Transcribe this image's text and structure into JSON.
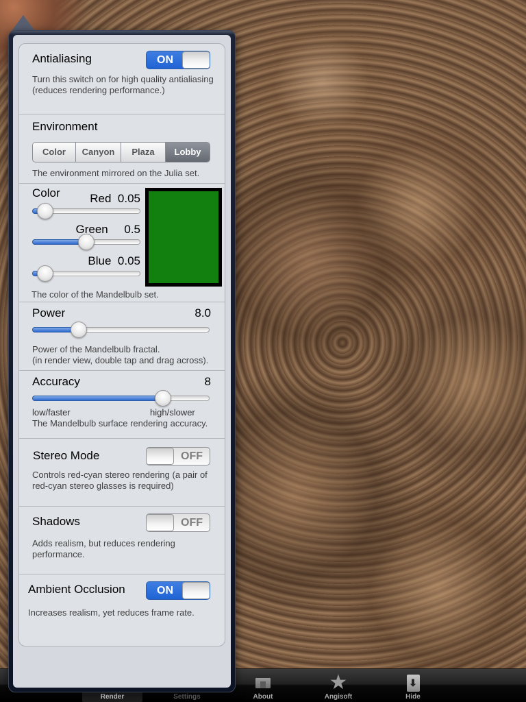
{
  "tabbar": {
    "tabs": [
      {
        "label": "Render",
        "icon": "render-icon",
        "selected": true
      },
      {
        "label": "Settings",
        "icon": "settings-icon",
        "selected": false
      },
      {
        "label": "About",
        "icon": "about-icon",
        "selected": false
      },
      {
        "label": "Angisoft",
        "icon": "star-icon",
        "selected": false
      },
      {
        "label": "Hide",
        "icon": "hide-arrow-icon",
        "selected": false
      }
    ]
  },
  "settings": {
    "antialiasing": {
      "title": "Antialiasing",
      "state": "ON",
      "description_line1": "Turn this switch on for high quality antialiasing",
      "description_line2": "(reduces rendering performance.)"
    },
    "environment": {
      "title": "Environment",
      "options": [
        "Color",
        "Canyon",
        "Plaza",
        "Lobby"
      ],
      "selected": "Lobby",
      "description": "The environment mirrored on the Julia set."
    },
    "color": {
      "title": "Color",
      "red": {
        "label": "Red",
        "value": "0.05",
        "fraction": 0.05
      },
      "green": {
        "label": "Green",
        "value": "0.5",
        "fraction": 0.5
      },
      "blue": {
        "label": "Blue",
        "value": "0.05",
        "fraction": 0.05
      },
      "swatch_color": "#11800f",
      "description": "The color of the Mandelbulb set."
    },
    "power": {
      "title": "Power",
      "value": "8.0",
      "fraction": 0.24,
      "description_line1": "Power of the Mandelbulb fractal.",
      "description_line2": "(in render view, double tap and drag across)."
    },
    "accuracy": {
      "title": "Accuracy",
      "value": "8",
      "fraction": 0.76,
      "min_label": "low/faster",
      "max_label": "high/slower",
      "description": "The Mandelbulb surface rendering accuracy."
    },
    "stereo_mode": {
      "title": "Stereo Mode",
      "state": "OFF",
      "description_line1": "Controls red-cyan stereo rendering (a pair of",
      "description_line2": "red-cyan stereo glasses is required)"
    },
    "shadows": {
      "title": "Shadows",
      "state": "OFF",
      "description_line1": "Adds realism, but reduces rendering",
      "description_line2": "performance."
    },
    "ambient_occlusion": {
      "title": "Ambient Occlusion",
      "state": "ON",
      "description": "Increases realism, yet reduces frame rate."
    }
  },
  "colors": {
    "switch_on": "#2a6ad8",
    "slider_fill": "#2e6ad0",
    "panel_bg": "#dee1e6"
  }
}
